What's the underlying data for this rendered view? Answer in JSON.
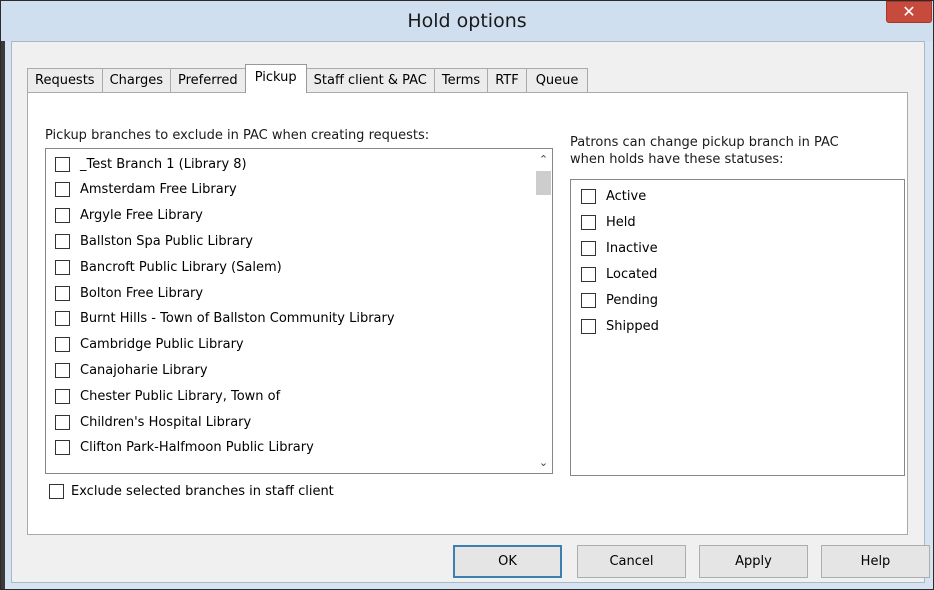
{
  "window": {
    "title": "Hold options",
    "close_glyph": "✕"
  },
  "tabs": [
    {
      "label": "Requests",
      "active": false
    },
    {
      "label": "Charges",
      "active": false
    },
    {
      "label": "Preferred",
      "active": false
    },
    {
      "label": "Pickup",
      "active": true
    },
    {
      "label": "Staff client & PAC",
      "active": false
    },
    {
      "label": "Terms",
      "active": false
    },
    {
      "label": "RTF",
      "active": false
    },
    {
      "label": "Queue",
      "active": false
    }
  ],
  "pickup": {
    "exclude_label": "Pickup branches to exclude in PAC when creating requests:",
    "branches": [
      {
        "label": "_Test Branch 1 (Library 8)",
        "checked": false
      },
      {
        "label": "Amsterdam Free Library",
        "checked": false
      },
      {
        "label": "Argyle Free Library",
        "checked": false
      },
      {
        "label": "Ballston Spa Public Library",
        "checked": false
      },
      {
        "label": "Bancroft Public Library (Salem)",
        "checked": false
      },
      {
        "label": "Bolton Free Library",
        "checked": false
      },
      {
        "label": "Burnt Hills - Town of Ballston Community Library",
        "checked": false
      },
      {
        "label": "Cambridge Public Library",
        "checked": false
      },
      {
        "label": "Canajoharie Library",
        "checked": false
      },
      {
        "label": "Chester Public Library, Town of",
        "checked": false
      },
      {
        "label": "Children's Hospital Library",
        "checked": false
      },
      {
        "label": "Clifton Park-Halfmoon Public Library",
        "checked": false
      }
    ],
    "status_label_line1": "Patrons can change pickup branch in PAC",
    "status_label_line2": "when holds have these statuses:",
    "statuses": [
      {
        "label": "Active",
        "checked": false
      },
      {
        "label": "Held",
        "checked": false
      },
      {
        "label": "Inactive",
        "checked": false
      },
      {
        "label": "Located",
        "checked": false
      },
      {
        "label": "Pending",
        "checked": false
      },
      {
        "label": "Shipped",
        "checked": false
      }
    ],
    "staff_client_label": "Exclude selected branches in staff client",
    "staff_client_checked": false
  },
  "buttons": {
    "ok": "OK",
    "cancel": "Cancel",
    "apply": "Apply",
    "help": "Help"
  },
  "icons": {
    "scroll_up": "chevron-up-icon",
    "scroll_down": "chevron-down-icon",
    "close": "close-icon"
  }
}
